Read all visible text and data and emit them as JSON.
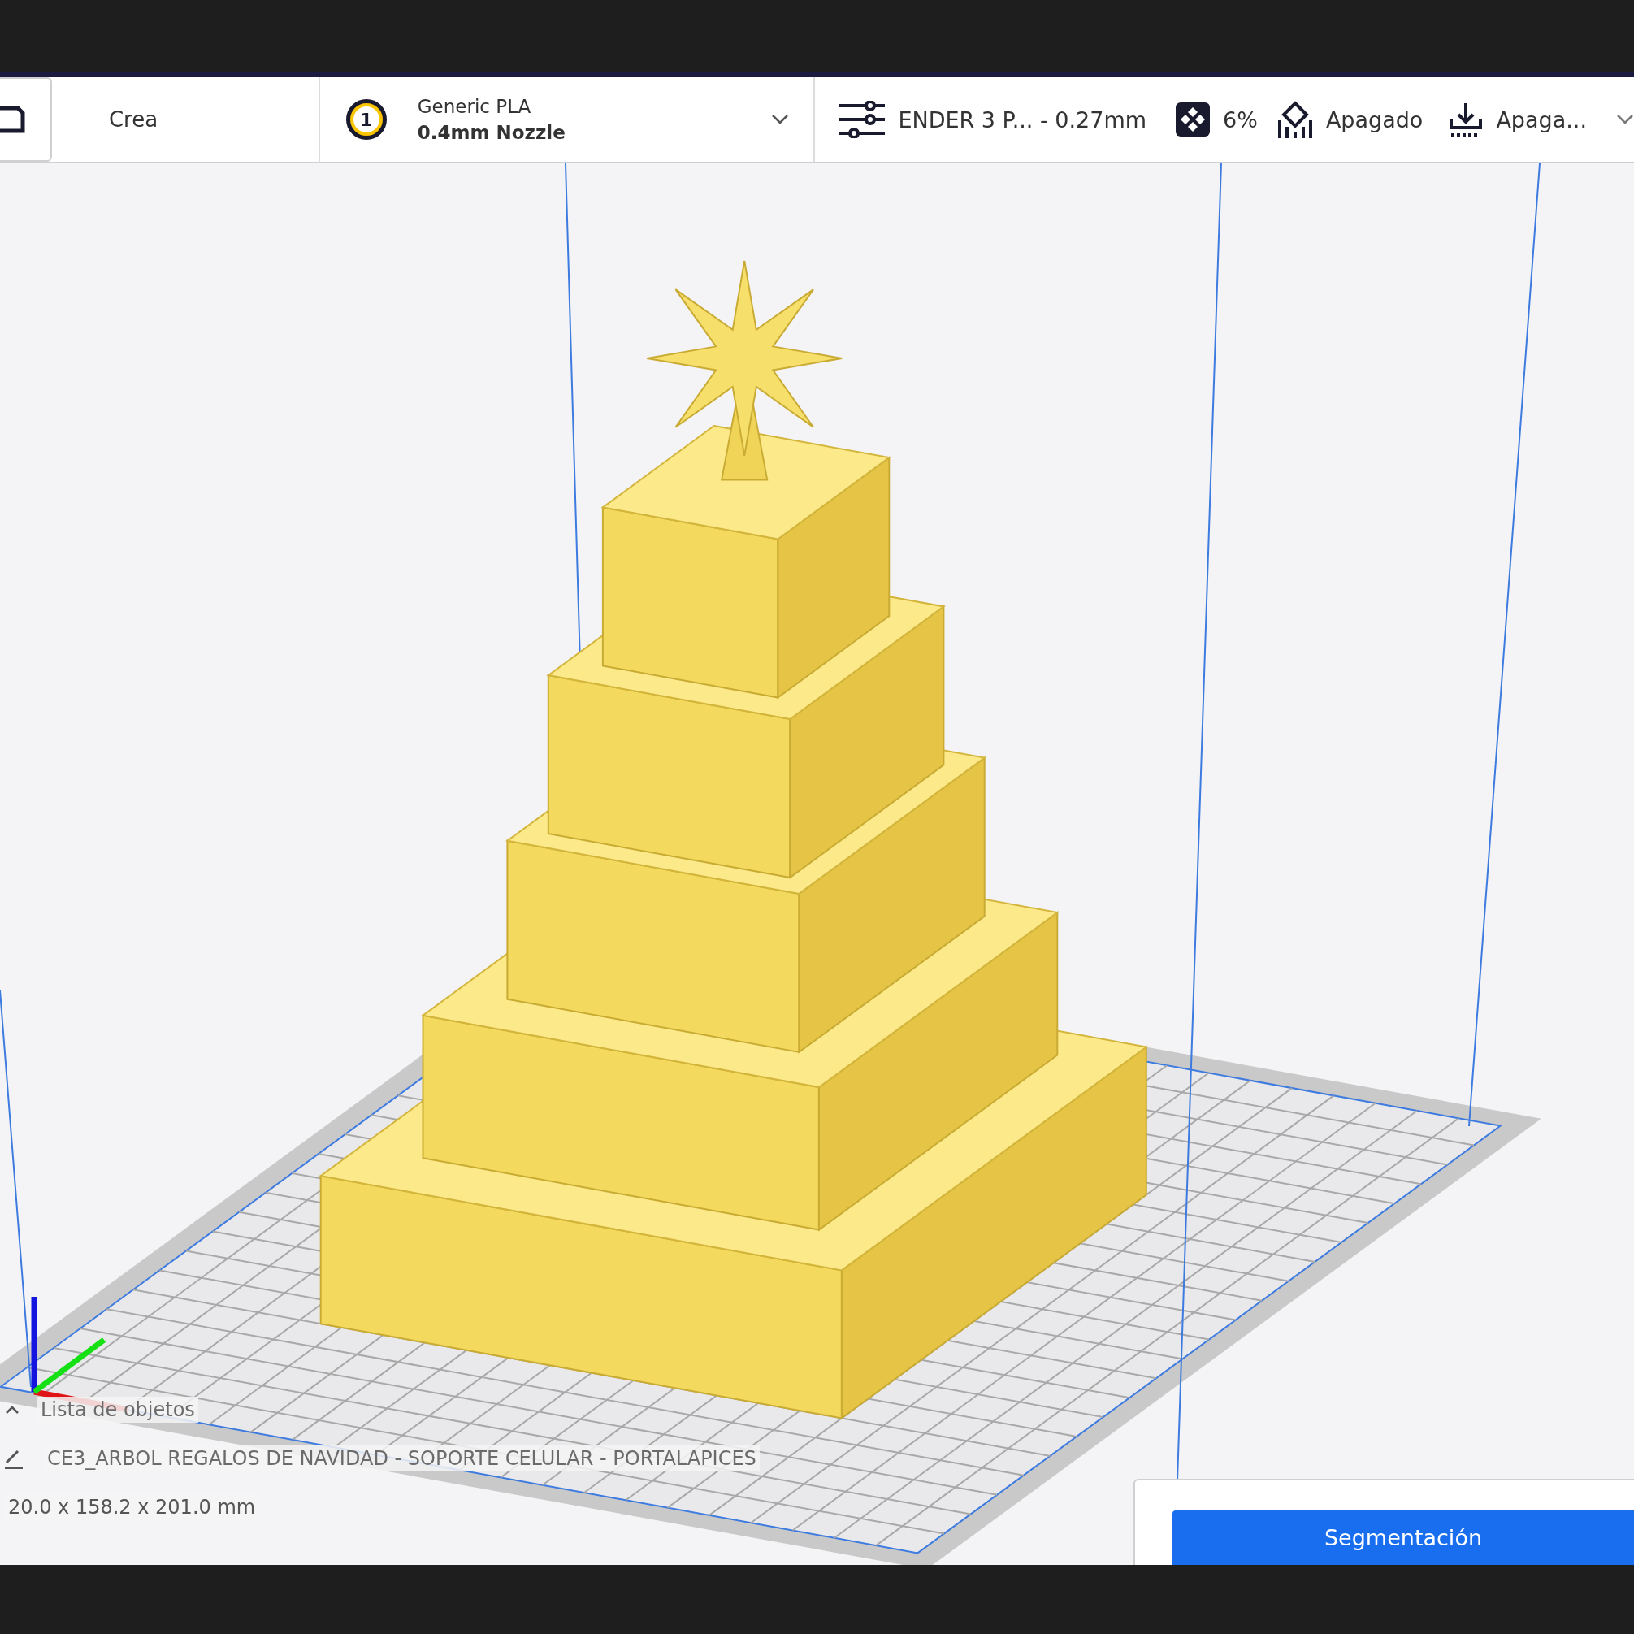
{
  "toolbar": {
    "stage_button": {
      "label": "Crea"
    },
    "material": {
      "extruder": "1",
      "material": "Generic PLA",
      "nozzle": "0.4mm Nozzle"
    },
    "print_settings": {
      "profile": "ENDER 3 P... - 0.27mm",
      "infill": "6%",
      "support": "Apagado",
      "adhesion": "Apaga..."
    }
  },
  "object_list": {
    "title": "Lista de objetos",
    "object_name": "CE3_ARBOL REGALOS DE NAVIDAD - SOPORTE CELULAR - PORTALAPICES",
    "dimensions": "20.0 x 158.2 x 201.0 mm"
  },
  "action_panel": {
    "button": "Segmentación"
  }
}
